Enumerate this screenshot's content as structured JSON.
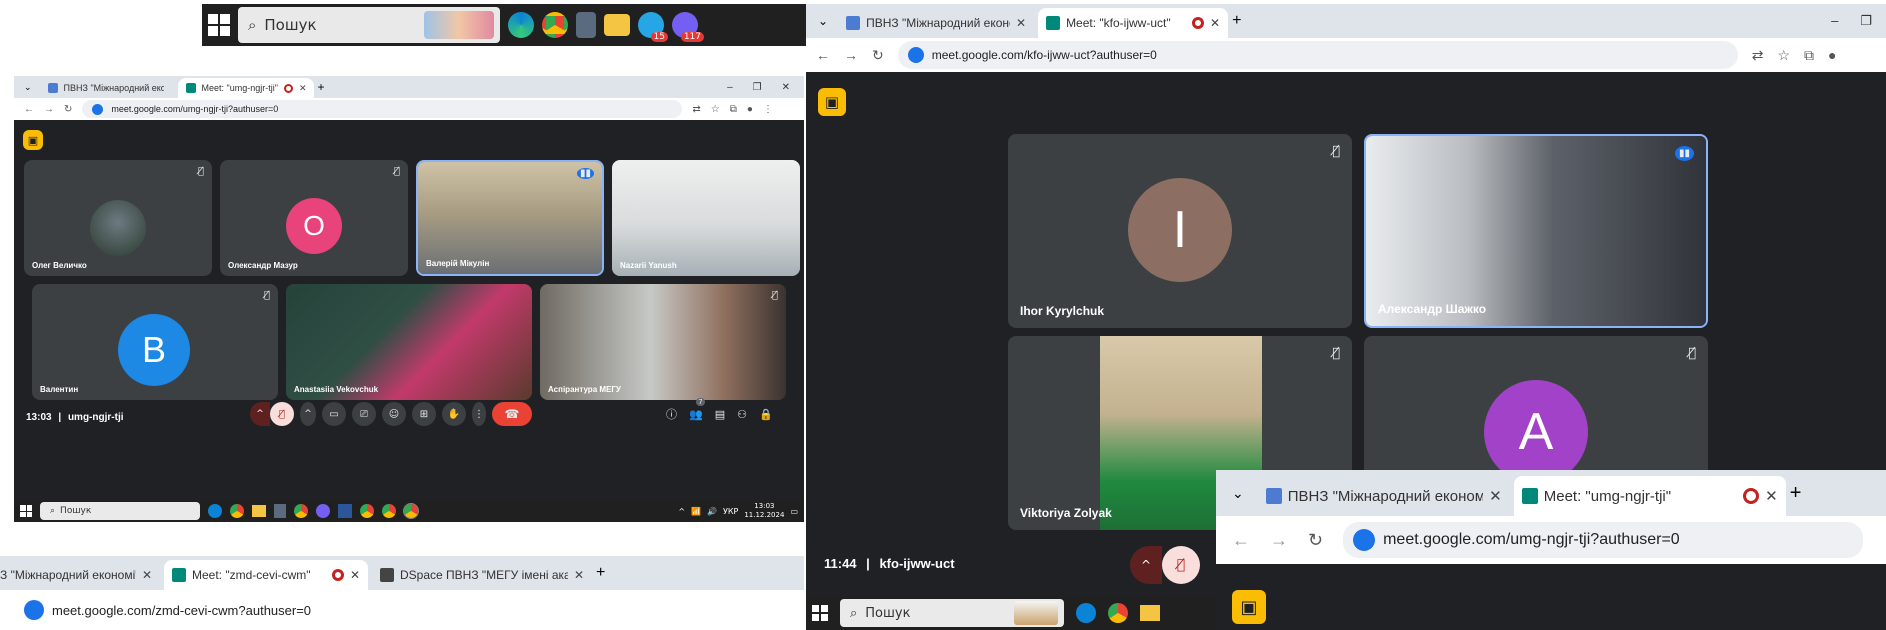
{
  "taskbar_top": {
    "search": "Пошук",
    "badge1": "15",
    "badge2": "117"
  },
  "left_window": {
    "tabs": [
      {
        "label": "ПВНЗ \"Міжнародний економі\""
      },
      {
        "label": "Meet: \"umg-ngjr-tji\""
      }
    ],
    "url": "meet.google.com/umg-ngjr-tji?authuser=0",
    "participants": [
      {
        "name": "Олег Величко"
      },
      {
        "name": "Олександр Мазур",
        "initial": "O"
      },
      {
        "name": "Валерій Мікулін"
      },
      {
        "name": "Nazarii Yanush"
      },
      {
        "name": "Валентин",
        "initial": "B"
      },
      {
        "name": "Anastasiia Vekovchuk"
      },
      {
        "name": "Аспірантура МЕГУ"
      }
    ],
    "time": "13:03",
    "meeting_code": "umg-ngjr-tji",
    "people_count": "7",
    "taskbar": {
      "search": "Пошук",
      "lang": "УКР",
      "clock_time": "13:03",
      "clock_date": "11.12.2024"
    }
  },
  "right_window": {
    "tabs": [
      {
        "label": "ПВНЗ \"Міжнародний економі\""
      },
      {
        "label": "Meet: \"kfo-ijww-uct\""
      }
    ],
    "url": "meet.google.com/kfo-ijww-uct?authuser=0",
    "participants": [
      {
        "name": "Ihor Kyrylchuk",
        "initial": "I"
      },
      {
        "name": "Александр Шажко"
      },
      {
        "name": "Viktoriya Zolyak"
      },
      {
        "name": "",
        "initial": "A"
      }
    ],
    "time": "11:44",
    "meeting_code": "kfo-ijww-uct",
    "taskbar": {
      "search": "Пошук"
    }
  },
  "bottom_left_window": {
    "tabs": [
      {
        "label": "З \"Міжнародний економі\""
      },
      {
        "label": "Meet: \"zmd-cevi-cwm\""
      },
      {
        "label": "DSpace ПВНЗ \"МЕГУ імені акад\""
      }
    ],
    "url": "meet.google.com/zmd-cevi-cwm?authuser=0"
  },
  "bottom_right_window": {
    "tabs": [
      {
        "label": "ПВНЗ \"Міжнародний економі\""
      },
      {
        "label": "Meet: \"umg-ngjr-tji\""
      }
    ],
    "url": "meet.google.com/umg-ngjr-tji?authuser=0"
  },
  "colors": {
    "meet_bg": "#202124",
    "tile": "#3c4043",
    "accent_blue": "#1a73e8",
    "end_call": "#ea4335",
    "avatar_pink": "#e8437a",
    "avatar_blue": "#1e88e5",
    "avatar_brown": "#8d6e63",
    "avatar_purple": "#a142c8"
  }
}
